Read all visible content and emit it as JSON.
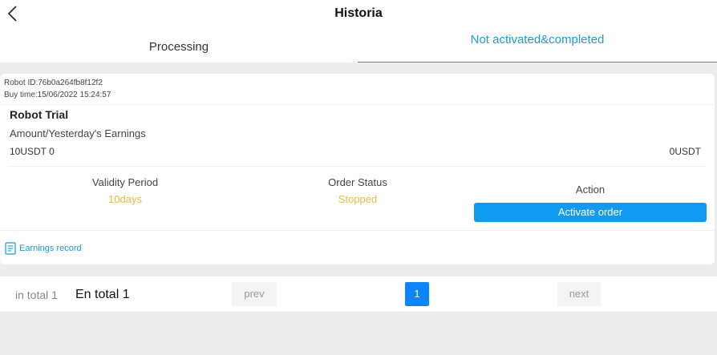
{
  "header": {
    "title": "Historia",
    "back_icon": "chevron-left-icon"
  },
  "tabs": [
    {
      "label": "Processing",
      "active": false
    },
    {
      "label": "Not activated&completed",
      "active": true
    }
  ],
  "order": {
    "robot_id": "Robot ID:76b0a264fb8f12f2",
    "buy_time": "Buy time:15/06/2022 15:24:57",
    "name": "Robot Trial",
    "amount_label": "Amount/Yesterday's Earnings",
    "amount_value": "10USDT 0",
    "earnings_value": "0USDT",
    "validity_label": "Validity Period",
    "validity_value": "10days",
    "status_label": "Order Status",
    "status_value": "Stopped",
    "action_label": "Action",
    "activate_button": "Activate order",
    "earnings_record_link": "Earnings record",
    "earnings_record_icon": "document-icon"
  },
  "pagination": {
    "in_total": "in total 1",
    "en_total": "En total 1",
    "prev": "prev",
    "current_page": "1",
    "next": "next"
  },
  "colors": {
    "accent": "#1a9ad6",
    "button": "#0f9bf2",
    "highlight": "#e5b94a",
    "page_active": "#0a84ff"
  }
}
